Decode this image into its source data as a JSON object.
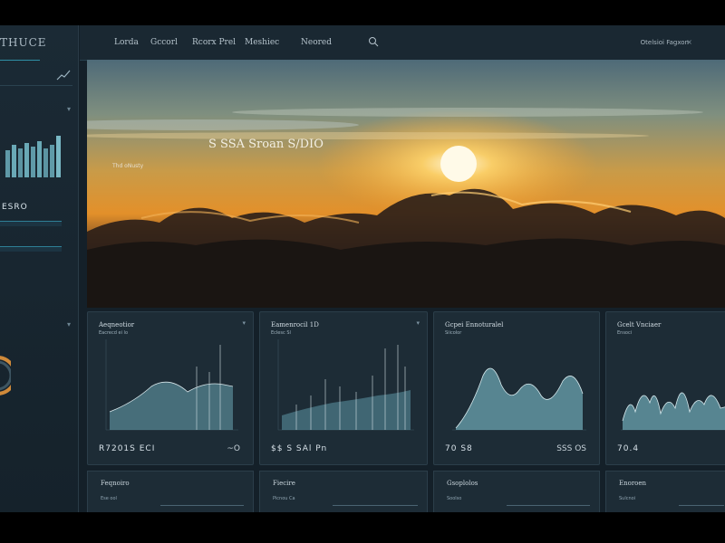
{
  "sidebar": {
    "brand": "THUCE",
    "label": "ESRO"
  },
  "topbar": {
    "nav": [
      "Lorda",
      "Gccorl",
      "Rcorx Prel",
      "Meshiec",
      "Neored"
    ],
    "user": "Otelsioi Fagxon"
  },
  "hero": {
    "title": "S SSA Sroan   S/DIO",
    "subtitle": "Thd oNusty"
  },
  "cards": [
    {
      "title": "Aeqneotior",
      "sub": "Eacrecd ei lo",
      "value": "R7201S  ECI",
      "value_right": "~O"
    },
    {
      "title": "Eamenrocil 1D",
      "sub": "Eclesc Sl",
      "value": "$$ S SAl  Pn",
      "value_right": ""
    },
    {
      "title": "Gcpei Ennoturalel",
      "sub": "Siicolor",
      "value": "70 S8",
      "value_right": "SSS OS"
    },
    {
      "title": "Gcelt Vnciaer",
      "sub": "Ensoci",
      "value": "70.4",
      "value_right": ""
    }
  ],
  "bottom_cards": [
    {
      "title": "Feqnoiro",
      "sub": "Ese ool"
    },
    {
      "title": "Fiecire",
      "sub": "Picnou Ca"
    },
    {
      "title": "Gsoplolos",
      "sub": "Soolso"
    },
    {
      "title": "Enoroen",
      "sub": "Sulcnoi"
    }
  ],
  "colors": {
    "accent": "#2f8fa6",
    "panel": "#1d2c36",
    "chart_fill": "#7fc1cf"
  }
}
